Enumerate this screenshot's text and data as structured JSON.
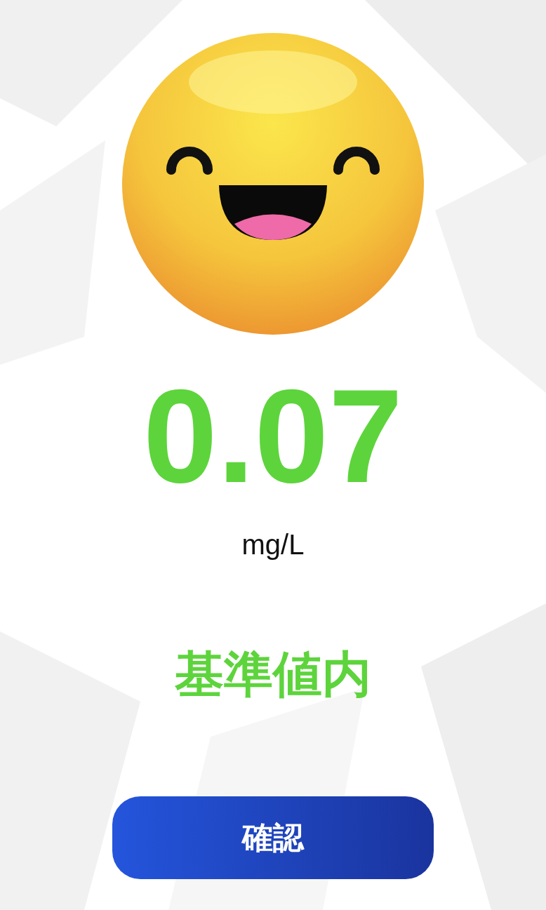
{
  "reading": {
    "value": "0.07",
    "unit": "mg/L"
  },
  "status": {
    "label": "基準値内"
  },
  "buttons": [
    {
      "label": "確認"
    }
  ]
}
